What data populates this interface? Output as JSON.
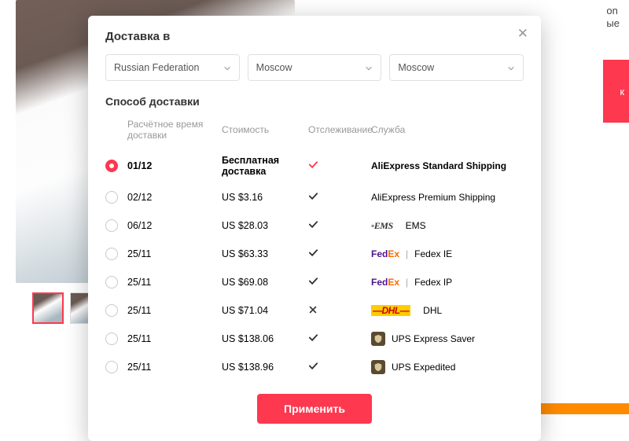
{
  "bg": {
    "text_fragment_1": "on",
    "text_fragment_2": "ые",
    "cta_fragment": "к"
  },
  "modal": {
    "title": "Доставка в",
    "close_glyph": "✕",
    "selects": {
      "country": "Russian Federation",
      "region": "Moscow",
      "city": "Moscow"
    },
    "subtitle": "Способ доставки",
    "headers": {
      "time": "Расчётное время доставки",
      "cost": "Стоимость",
      "tracking": "Отслеживание",
      "service": "Служба"
    },
    "options": [
      {
        "selected": true,
        "date": "01/12",
        "cost": "Бесплатная доставка",
        "free": true,
        "tracking": "partial",
        "service_name": "AliExpress Standard Shipping",
        "logo": ""
      },
      {
        "selected": false,
        "date": "02/12",
        "cost": "US $3.16",
        "free": false,
        "tracking": "yes",
        "service_name": "AliExpress Premium Shipping",
        "logo": ""
      },
      {
        "selected": false,
        "date": "06/12",
        "cost": "US $28.03",
        "free": false,
        "tracking": "yes",
        "service_name": "EMS",
        "logo": "ems"
      },
      {
        "selected": false,
        "date": "25/11",
        "cost": "US $63.33",
        "free": false,
        "tracking": "yes",
        "service_name": "Fedex IE",
        "logo": "fedex"
      },
      {
        "selected": false,
        "date": "25/11",
        "cost": "US $69.08",
        "free": false,
        "tracking": "yes",
        "service_name": "Fedex IP",
        "logo": "fedex"
      },
      {
        "selected": false,
        "date": "25/11",
        "cost": "US $71.04",
        "free": false,
        "tracking": "no",
        "service_name": "DHL",
        "logo": "dhl"
      },
      {
        "selected": false,
        "date": "25/11",
        "cost": "US $138.06",
        "free": false,
        "tracking": "yes",
        "service_name": "UPS Express Saver",
        "logo": "ups"
      },
      {
        "selected": false,
        "date": "25/11",
        "cost": "US $138.96",
        "free": false,
        "tracking": "yes",
        "service_name": "UPS Expedited",
        "logo": "ups"
      }
    ],
    "apply": "Применить"
  },
  "logos": {
    "ems_text": "EMS",
    "fedex_text": "FedEx",
    "dhl_text": "DHL"
  }
}
